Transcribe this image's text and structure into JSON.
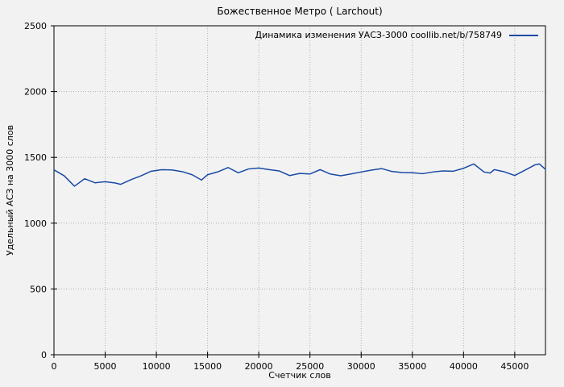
{
  "title": "Божественное Метро ( Larchout)",
  "legend": {
    "label": "Динамика изменения УАСЗ-3000 coollib.net/b/758749"
  },
  "axes": {
    "x_label": "Счетчик слов",
    "y_label": "Удельный АСЗ на 3000 слов"
  },
  "colors": {
    "background": "#f2f2f2",
    "line": "#1a4aa5",
    "grid": "#b0b0b0",
    "axis": "#000000",
    "text": "#000000"
  },
  "chart_data": {
    "type": "line",
    "title": "Божественное Метро ( Larchout)",
    "xlabel": "Счетчик слов",
    "ylabel": "Удельный АСЗ на 3000 слов",
    "xlim": [
      0,
      48000
    ],
    "ylim": [
      0,
      2500
    ],
    "xticks": [
      0,
      5000,
      10000,
      15000,
      20000,
      25000,
      30000,
      35000,
      40000,
      45000
    ],
    "yticks": [
      0,
      500,
      1000,
      1500,
      2000,
      2500
    ],
    "grid": true,
    "grid_style": "dotted",
    "legend_position": "top-right-inside",
    "series": [
      {
        "name": "Динамика изменения УАСЗ-3000 coollib.net/b/758749",
        "x": [
          0,
          1000,
          2000,
          3000,
          4000,
          5000,
          6000,
          6500,
          7500,
          8500,
          9500,
          10500,
          11500,
          12500,
          13500,
          14400,
          15000,
          16000,
          17000,
          18000,
          19000,
          20000,
          21000,
          22000,
          23000,
          24000,
          25000,
          26000,
          27000,
          28000,
          29000,
          30000,
          31000,
          32000,
          33000,
          34000,
          35000,
          36000,
          37000,
          38000,
          39000,
          40000,
          41000,
          42000,
          42600,
          43000,
          44000,
          45000,
          46000,
          47000,
          47400,
          48000
        ],
        "values": [
          1405,
          1360,
          1281,
          1338,
          1307,
          1315,
          1305,
          1295,
          1330,
          1360,
          1395,
          1406,
          1405,
          1392,
          1368,
          1328,
          1368,
          1390,
          1423,
          1383,
          1412,
          1419,
          1407,
          1397,
          1362,
          1378,
          1374,
          1407,
          1373,
          1360,
          1374,
          1389,
          1403,
          1415,
          1393,
          1385,
          1383,
          1376,
          1389,
          1397,
          1395,
          1417,
          1450,
          1389,
          1381,
          1407,
          1390,
          1362,
          1403,
          1444,
          1450,
          1409
        ]
      }
    ]
  }
}
